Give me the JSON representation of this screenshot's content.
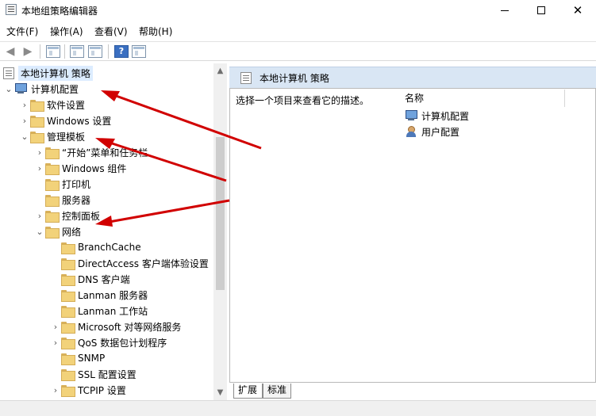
{
  "window": {
    "title": "本地组策略编辑器"
  },
  "menu": {
    "items": [
      "文件(F)",
      "操作(A)",
      "查看(V)",
      "帮助(H)"
    ]
  },
  "toolbar": {
    "help_label": "?"
  },
  "tree": {
    "root": "本地计算机 策略",
    "computer_config": "计算机配置",
    "software_settings": "软件设置",
    "windows_settings": "Windows 设置",
    "admin_templates": "管理模板",
    "start_menu": "“开始”菜单和任务栏",
    "windows_components": "Windows 组件",
    "printers": "打印机",
    "servers": "服务器",
    "control_panel": "控制面板",
    "network": "网络",
    "network_items": [
      "BranchCache",
      "DirectAccess 客户端体验设置",
      "DNS 客户端",
      "Lanman 服务器",
      "Lanman 工作站",
      "Microsoft 对等网络服务",
      "QoS 数据包计划程序",
      "SNMP",
      "SSL 配置设置",
      "TCPIP 设置"
    ]
  },
  "right": {
    "title": "本地计算机 策略",
    "description": "选择一个项目来查看它的描述。",
    "column_header": "名称",
    "items": [
      "计算机配置",
      "用户配置"
    ],
    "tabs": [
      "扩展",
      "标准"
    ]
  },
  "colors": {
    "arrow": "#d10000",
    "header_bg": "#d9e6f4",
    "selection": "#dcecff"
  }
}
